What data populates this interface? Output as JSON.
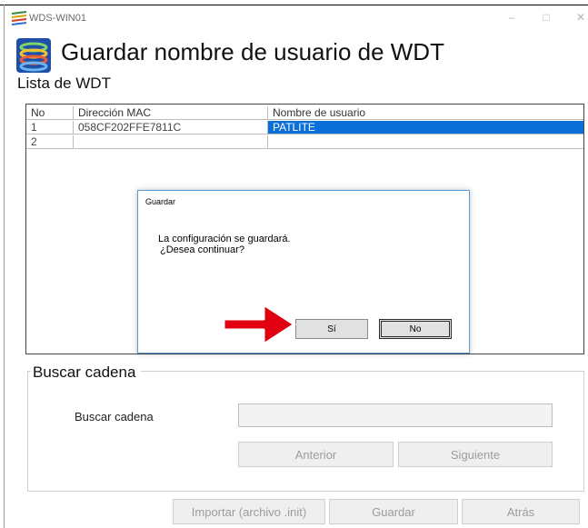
{
  "window": {
    "title": "WDS-WIN01",
    "controls": {
      "minimize": "–",
      "maximize": "□",
      "close": "✕"
    }
  },
  "header": {
    "title": "Guardar nombre de usuario de WDT",
    "list_label": "Lista de WDT"
  },
  "table": {
    "columns": [
      "No",
      "Dirección MAC",
      "Nombre de usuario"
    ],
    "rows": [
      {
        "no": "1",
        "mac": "058CF202FFE7811C",
        "user": "PATLITE",
        "selected": true
      },
      {
        "no": "2",
        "mac": "",
        "user": "",
        "selected": false
      }
    ]
  },
  "dialog": {
    "title": "Guardar",
    "line1": "La configuración se guardará.",
    "line2": "¿Desea continuar?",
    "yes_label": "Sí",
    "no_label": "No"
  },
  "search": {
    "group_title": "Buscar cadena",
    "label": "Buscar cadena",
    "value": "",
    "prev_label": "Anterior",
    "next_label": "Siguiente"
  },
  "footer": {
    "import_label": "Importar (archivo .init)",
    "save_label": "Guardar",
    "back_label": "Atrás"
  },
  "colors": {
    "selection": "#0a6fd6",
    "arrow": "#e0000f",
    "dialog_border": "#5b9bd5"
  }
}
